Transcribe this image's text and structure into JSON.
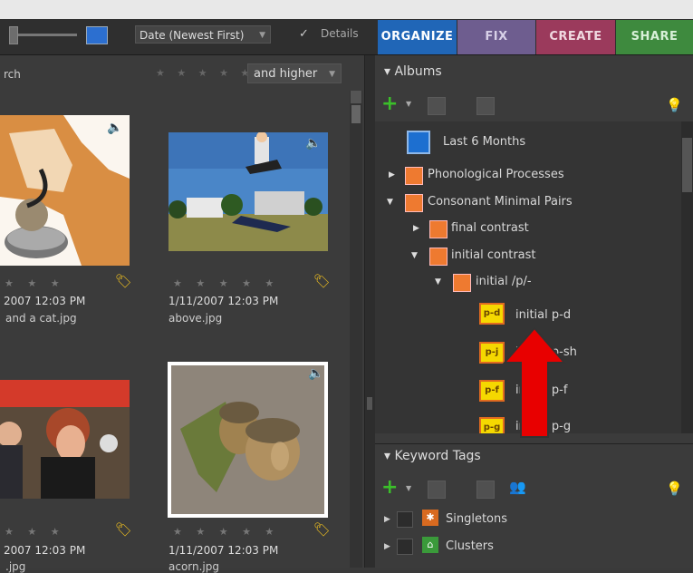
{
  "toolbar": {
    "sort_label": "Date (Newest First)",
    "details_label": "Details",
    "details_checked": "✓"
  },
  "tabs": [
    "ORGANIZE",
    "FIX",
    "CREATE",
    "SHARE"
  ],
  "filter": {
    "search_label": "rch",
    "rating_label": "and higher",
    "stars": "★ ★ ★ ★ ★"
  },
  "photos": [
    {
      "stars": "★ ★ ★",
      "date": "2007 12:03 PM",
      "name": "and a cat.jpg"
    },
    {
      "stars": "★ ★ ★ ★ ★",
      "date": "1/11/2007 12:03 PM",
      "name": "above.jpg"
    },
    {
      "stars": "★ ★ ★",
      "date": "2007 12:03 PM",
      "name": ".jpg"
    },
    {
      "stars": "★ ★ ★ ★ ★",
      "date": "1/11/2007 12:03 PM",
      "name": "acorn.jpg"
    }
  ],
  "albums": {
    "title": "Albums",
    "items": [
      {
        "label": "Last 6 Months"
      },
      {
        "label": "Phonological Processes"
      },
      {
        "label": "Consonant Minimal Pairs"
      },
      {
        "label": "final contrast"
      },
      {
        "label": "initial contrast"
      },
      {
        "label": "initial /p/-"
      },
      {
        "label": "initial p-d",
        "icon": "p-d"
      },
      {
        "label": "initial p-sh",
        "icon": "p-j"
      },
      {
        "label": "initial p-f",
        "icon": "p-f"
      },
      {
        "label": "initial p-g",
        "icon": "p-g"
      }
    ]
  },
  "keywords": {
    "title": "Keyword Tags",
    "items": [
      {
        "label": "Singletons"
      },
      {
        "label": "Clusters"
      }
    ]
  },
  "colors": {
    "organize": "#2066b7",
    "fix": "#6e5d8f",
    "create": "#9b3a5c",
    "share": "#3e8a3e",
    "annotation": "#e80000"
  }
}
